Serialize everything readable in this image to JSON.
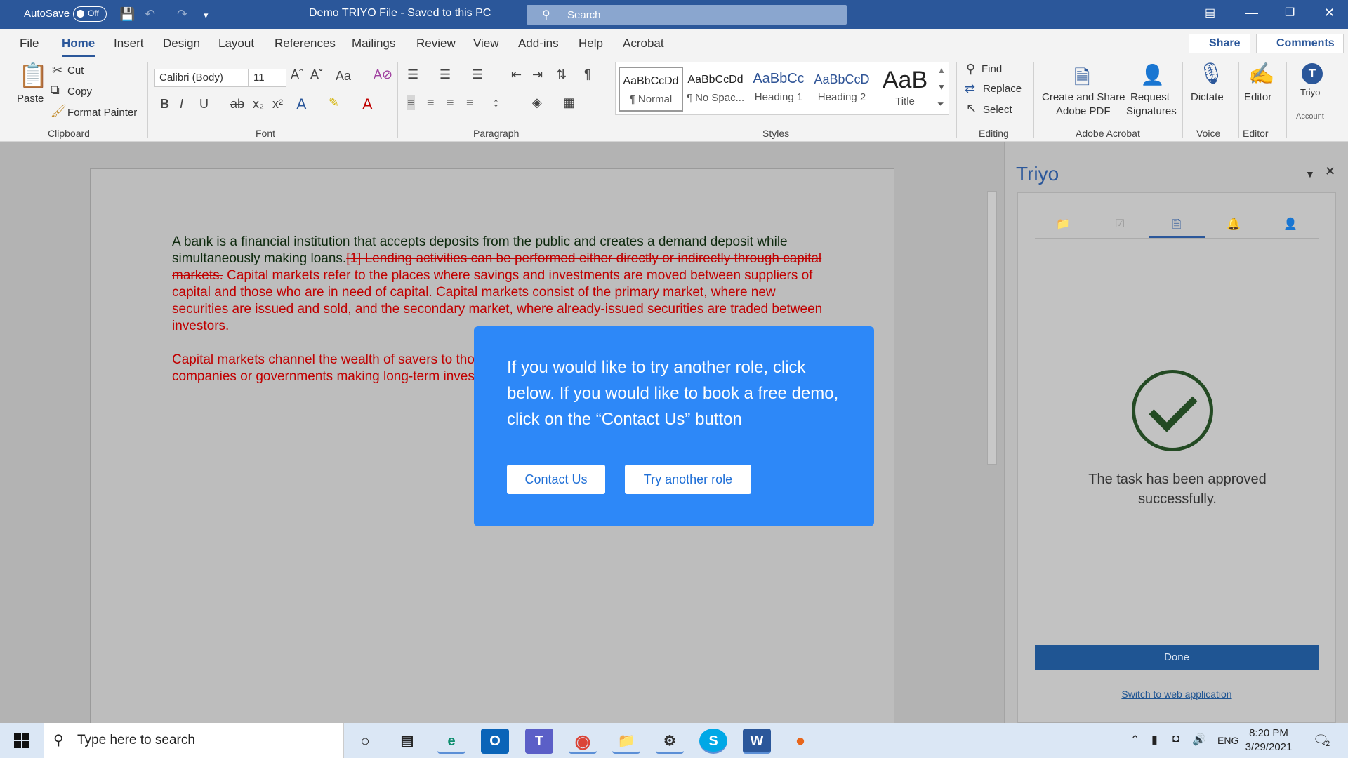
{
  "titlebar": {
    "autosave_label": "AutoSave",
    "autosave_state": "Off",
    "doc_title": "Demo TRIYO File  -  Saved to this PC",
    "search_placeholder": "Search"
  },
  "tabs": [
    "File",
    "Home",
    "Insert",
    "Design",
    "Layout",
    "References",
    "Mailings",
    "Review",
    "View",
    "Add-ins",
    "Help",
    "Acrobat"
  ],
  "active_tab": "Home",
  "share_label": "Share",
  "comments_label": "Comments",
  "ribbon": {
    "clipboard": {
      "paste": "Paste",
      "cut": "Cut",
      "copy": "Copy",
      "format_painter": "Format Painter",
      "group": "Clipboard"
    },
    "font": {
      "family": "Calibri (Body)",
      "size": "11",
      "group": "Font"
    },
    "paragraph": {
      "group": "Paragraph"
    },
    "styles": {
      "group": "Styles",
      "items": [
        {
          "sample": "AaBbCcDd",
          "name": "¶ Normal"
        },
        {
          "sample": "AaBbCcDd",
          "name": "¶ No Spac..."
        },
        {
          "sample": "AaBbCc",
          "name": "Heading 1"
        },
        {
          "sample": "AaBbCcD",
          "name": "Heading 2"
        },
        {
          "sample": "AaB",
          "name": "Title"
        }
      ]
    },
    "editing": {
      "find": "Find",
      "replace": "Replace",
      "select": "Select",
      "group": "Editing"
    },
    "acrobat": {
      "create": "Create and Share",
      "create2": "Adobe PDF",
      "request": "Request",
      "request2": "Signatures",
      "group": "Adobe Acrobat"
    },
    "voice": {
      "dictate": "Dictate",
      "group": "Voice"
    },
    "editor": {
      "editor": "Editor",
      "group": "Editor"
    },
    "triyo": {
      "label": "Triyo",
      "account": "Account"
    }
  },
  "document": {
    "p1_normal": "A bank is a financial institution that accepts deposits from the public and creates a demand deposit while simultaneously making loans.",
    "p1_deleted": "[1] Lending activities can be performed either directly or indirectly through capital markets.",
    "p1_inserted": " Capital markets refer to the places where savings and investments are moved between suppliers of capital and those who are in need of capital. Capital markets consist of the primary market, where new securities are issued and sold, and the secondary market, where already-issued securities are traded between investors.",
    "p2": "Capital markets channel the wealth of savers to those who can put it to long-term productive use, such as companies or governments making long-term investments."
  },
  "modal": {
    "message": "If you would like to try another role, click below. If you would like to book a free demo, click on the “Contact Us” button",
    "contact_label": "Contact Us",
    "try_label": "Try another role"
  },
  "pane": {
    "title": "Triyo",
    "tabs": [
      "folder-icon",
      "clipboard-icon",
      "document-search-icon",
      "bell-icon",
      "user-icon"
    ],
    "active_tab": 2,
    "message": "The task has been approved successfully.",
    "done_label": "Done",
    "web_link": "Switch to web application"
  },
  "taskbar": {
    "search_placeholder": "Type here to search",
    "apps": [
      "cortana",
      "task-view",
      "edge",
      "outlook",
      "teams",
      "chrome",
      "file-explorer",
      "settings",
      "skype",
      "word",
      "firefox"
    ],
    "language": "ENG",
    "time": "8:20 PM",
    "date": "3/29/2021",
    "notifications": "2"
  }
}
